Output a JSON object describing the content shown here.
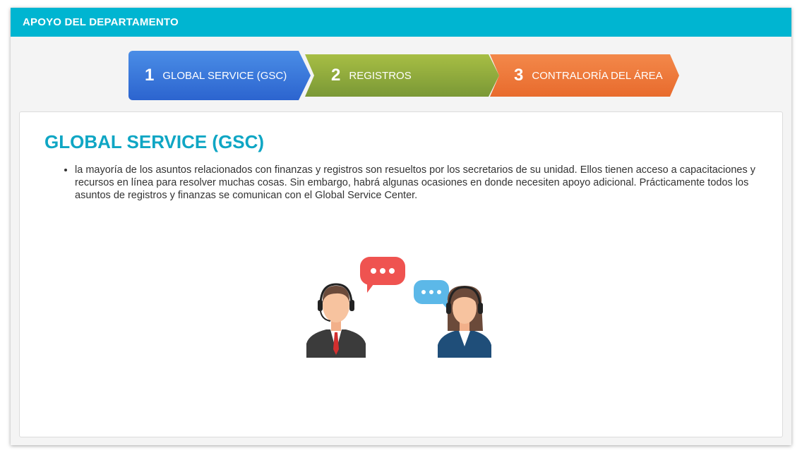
{
  "window": {
    "title": "APOYO DEL DEPARTAMENTO"
  },
  "steps": [
    {
      "number": "1",
      "label": "GLOBAL SERVICE (GSC)",
      "color": "#2f6fd8",
      "active": true
    },
    {
      "number": "2",
      "label": "REGISTROS",
      "color": "#8fab3c",
      "active": false
    },
    {
      "number": "3",
      "label": "CONTRALORÍA DEL ÁREA",
      "color": "#ee7a3a",
      "active": false
    }
  ],
  "content": {
    "heading": "GLOBAL SERVICE (GSC)",
    "bullets": [
      "la mayoría de los asuntos relacionados con finanzas y registros son resueltos por los secretarios de su unidad. Ellos tienen acceso a capacitaciones y recursos en línea para resolver muchas cosas. Sin embargo, habrá algunas ocasiones en donde necesiten apoyo adicional.  Prácticamente todos los asuntos de registros y finanzas se comunican con el Global Service Center."
    ],
    "illustration": "two-support-agents-with-headsets-and-speech-bubbles"
  },
  "colors": {
    "titlebar": "#00b5d1",
    "heading": "#0fa6c4",
    "bubble_red": "#ef5350",
    "bubble_blue": "#5cb8e8"
  }
}
